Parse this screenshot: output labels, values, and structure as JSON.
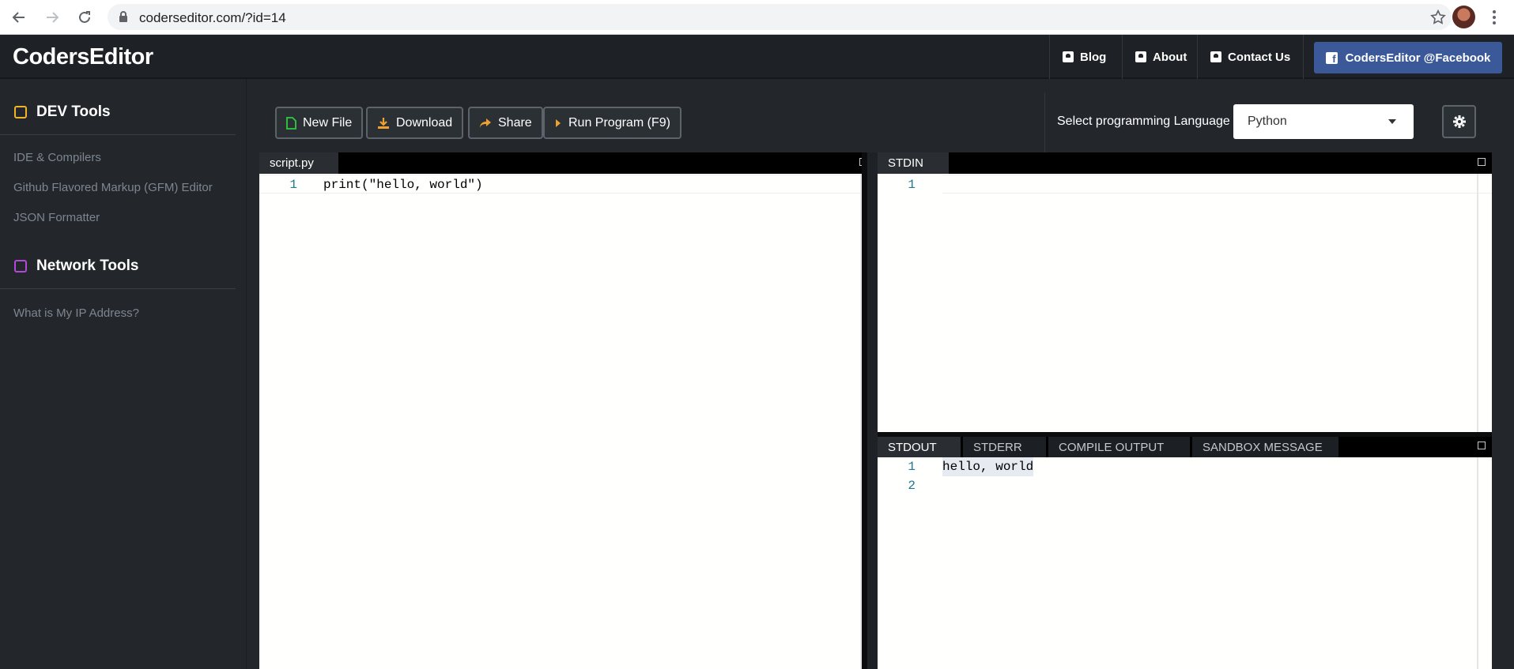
{
  "browser": {
    "url": "coderseditor.com/?id=14"
  },
  "header": {
    "brand": "CodersEditor",
    "nav": [
      {
        "label": "Blog",
        "icon": "contact-card-icon"
      },
      {
        "label": "About",
        "icon": "contact-card-icon"
      },
      {
        "label": "Contact Us",
        "icon": "contact-card-icon"
      }
    ],
    "facebook_label": "CodersEditor @Facebook"
  },
  "sidebar": {
    "sections": [
      {
        "title": "DEV Tools",
        "color": "#f0b429",
        "links": [
          "IDE & Compilers",
          "Github Flavored Markup (GFM) Editor",
          "JSON Formatter"
        ]
      },
      {
        "title": "Network Tools",
        "color": "#b04ad6",
        "links": [
          "What is My IP Address?"
        ]
      }
    ]
  },
  "toolbar": {
    "new_file": "New File",
    "download": "Download",
    "share": "Share",
    "run": "Run Program (F9)",
    "language_label": "Select programming Language |",
    "language_selected": "Python"
  },
  "editor": {
    "tab": "script.py",
    "lines": [
      {
        "n": "1",
        "text": "print(\"hello, world\")"
      }
    ]
  },
  "stdin": {
    "tab": "STDIN",
    "lines": [
      {
        "n": "1",
        "text": ""
      }
    ]
  },
  "output": {
    "tabs": [
      "STDOUT",
      "STDERR",
      "COMPILE OUTPUT",
      "SANDBOX MESSAGE"
    ],
    "active_tab": "STDOUT",
    "lines": [
      {
        "n": "1",
        "text": "hello, world"
      },
      {
        "n": "2",
        "text": ""
      }
    ]
  },
  "colors": {
    "accent_green": "#2ecc40",
    "accent_orange": "#f0a030",
    "facebook_blue": "#3b5998"
  }
}
